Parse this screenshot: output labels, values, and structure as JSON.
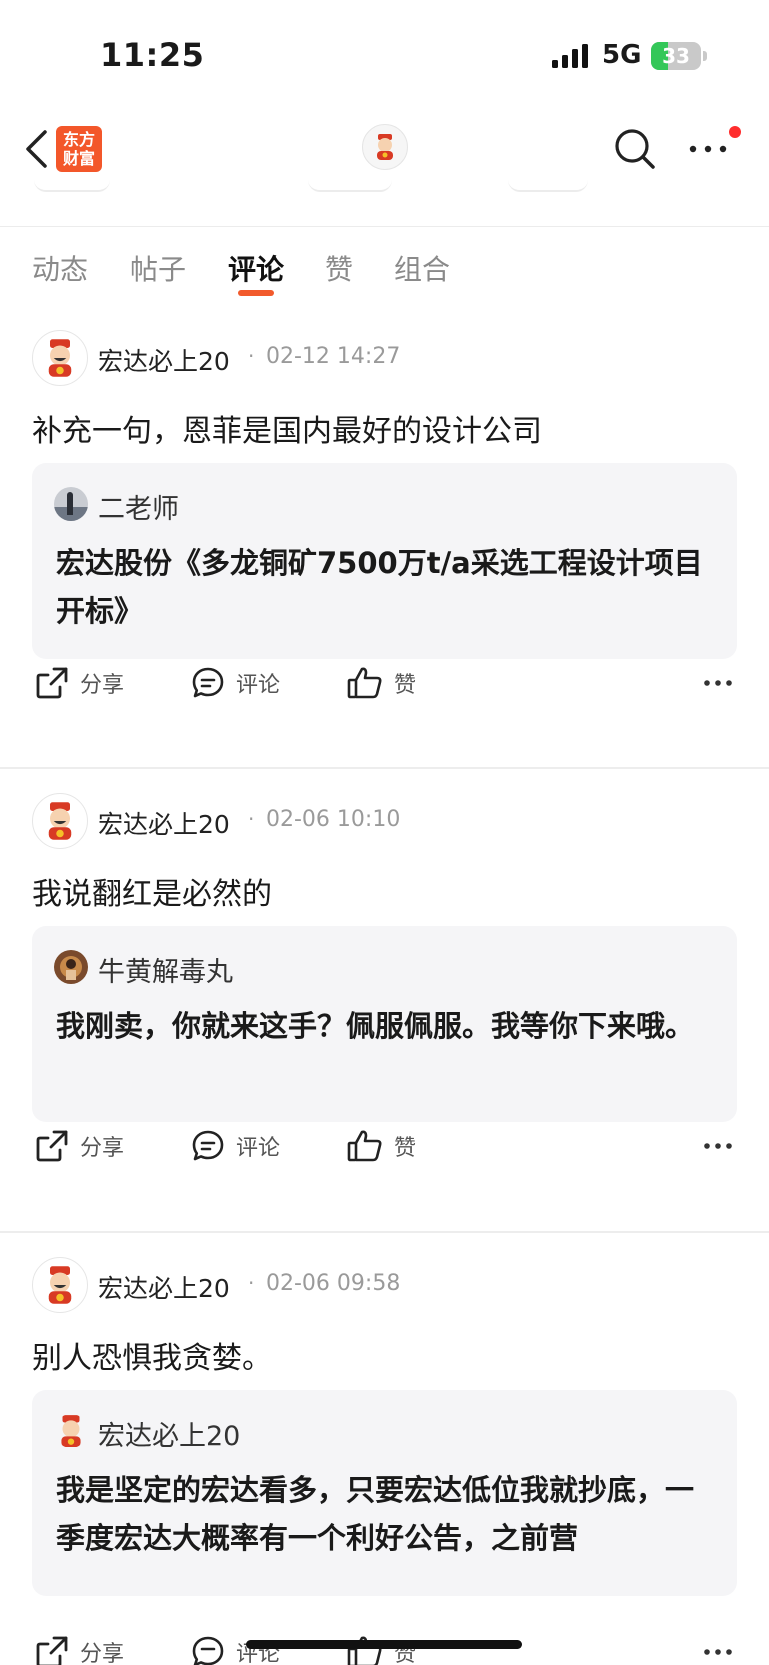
{
  "status_bar": {
    "time": "11:25",
    "network": "5G",
    "battery_level": "33",
    "battery_percent": 0.33,
    "battery_color": "#34c759"
  },
  "nav": {
    "back_icon": "chevron-left-icon",
    "app_logo_text": "东方财富",
    "app_logo_color": "#f3572a",
    "search_icon": "search-icon",
    "more_icon": "more-horizontal-icon",
    "notification_dot_color": "#ff2d2d"
  },
  "tabs": [
    {
      "label": "动态",
      "active": false
    },
    {
      "label": "帖子",
      "active": false
    },
    {
      "label": "评论",
      "active": true
    },
    {
      "label": "赞",
      "active": false
    },
    {
      "label": "组合",
      "active": false
    }
  ],
  "accent_color": "#f25a2c",
  "posts": [
    {
      "author": "宏达必上20",
      "time": "02-12 14:27",
      "text": "补充一句，恩菲是国内最好的设计公司",
      "quote": {
        "author": "二老师",
        "text": "宏达股份《多龙铜矿7500万t/a采选工程设计项目开标》"
      },
      "actions": {
        "share": "分享",
        "comment": "评论",
        "like": "赞"
      }
    },
    {
      "author": "宏达必上20",
      "time": "02-06 10:10",
      "text": "我说翻红是必然的",
      "quote": {
        "author": "牛黄解毒丸",
        "text": "我刚卖，你就来这手？佩服佩服。我等你下来哦。"
      },
      "actions": {
        "share": "分享",
        "comment": "评论",
        "like": "赞"
      }
    },
    {
      "author": "宏达必上20",
      "time": "02-06 09:58",
      "text": "别人恐惧我贪婪。",
      "quote": {
        "author": "宏达必上20",
        "text": "我是坚定的宏达看多，只要宏达低位我就抄底，一季度宏达大概率有一个利好公告，之前营"
      },
      "actions": {
        "share": "分享",
        "comment": "评论",
        "like": "赞"
      }
    }
  ]
}
